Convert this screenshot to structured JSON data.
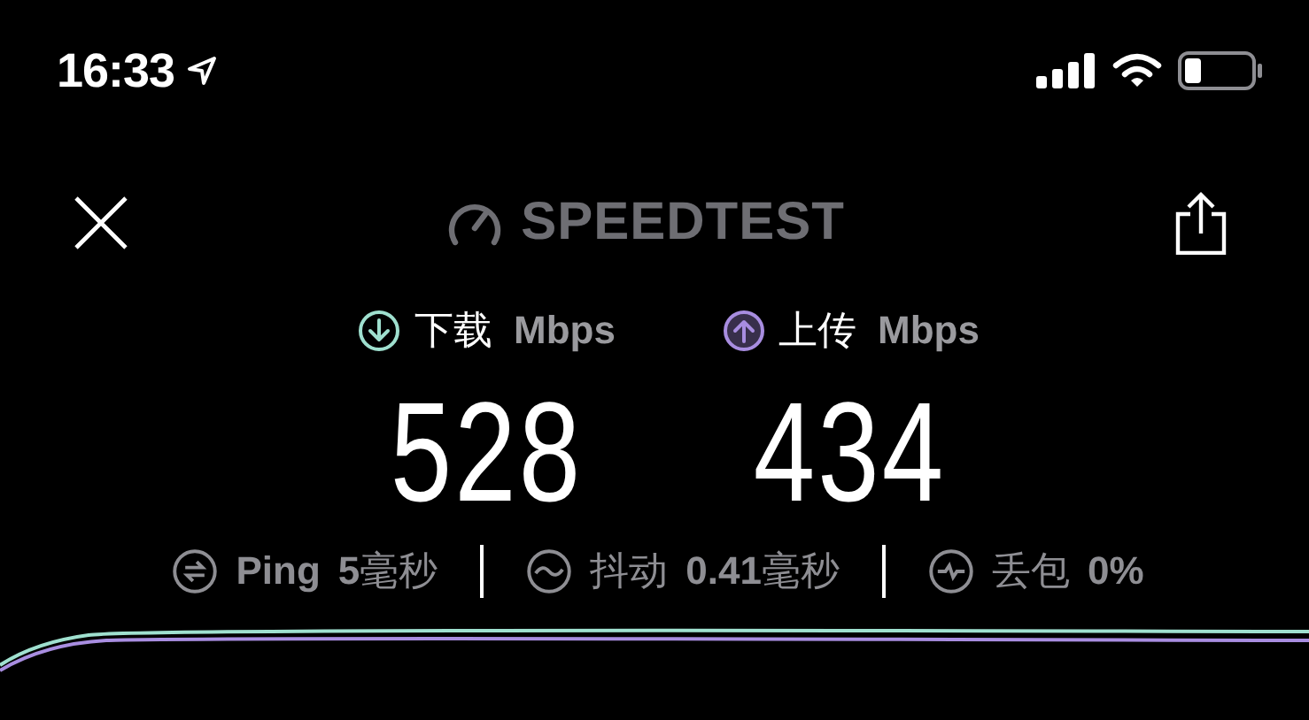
{
  "status_bar": {
    "time": "16:33"
  },
  "header": {
    "logo": "SPEEDTEST"
  },
  "results": [
    {
      "kind": "download",
      "label": "下载",
      "unit": "Mbps",
      "value": "528",
      "color": "#9fe0cf"
    },
    {
      "kind": "upload",
      "label": "上传",
      "unit": "Mbps",
      "value": "434",
      "color": "#a88de0"
    }
  ],
  "stats": [
    {
      "kind": "ping",
      "label": "Ping",
      "value": "**5**毫秒"
    },
    {
      "kind": "jitter",
      "label": "抖动",
      "value": "**0.41**毫秒"
    },
    {
      "kind": "loss",
      "label": "丢包",
      "value": "**0%**"
    }
  ]
}
